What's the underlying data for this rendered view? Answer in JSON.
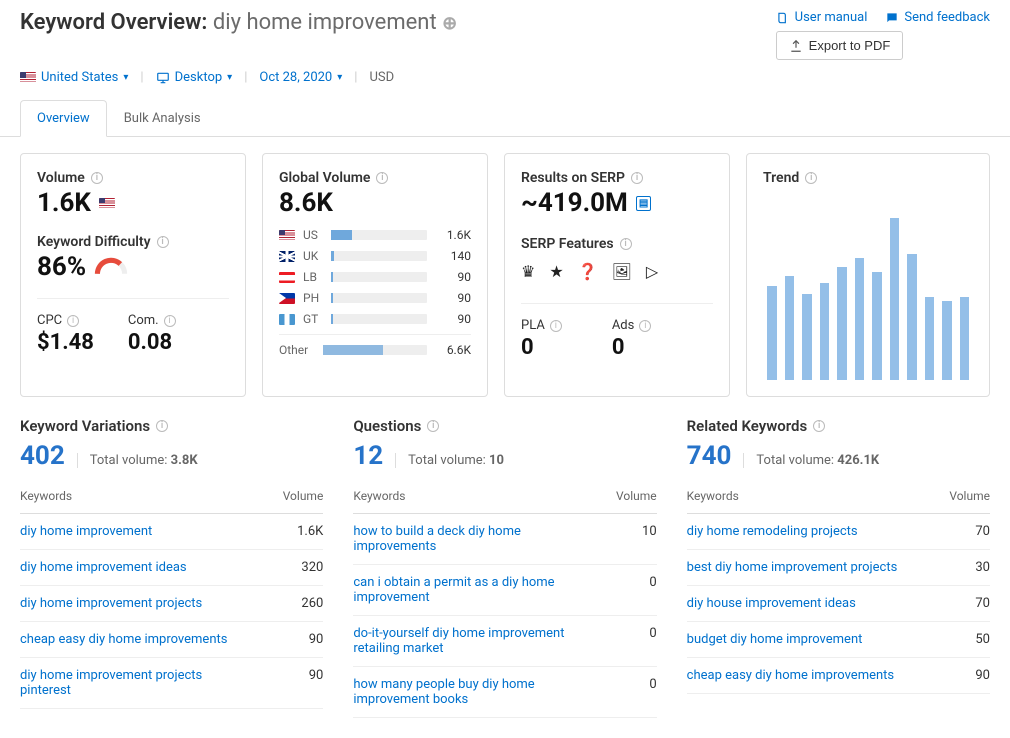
{
  "header": {
    "title_prefix": "Keyword Overview:",
    "keyword": "diy home improvement",
    "user_manual": "User manual",
    "send_feedback": "Send feedback",
    "export": "Export to PDF"
  },
  "filters": {
    "country": "United States",
    "device": "Desktop",
    "date": "Oct 28, 2020",
    "currency": "USD"
  },
  "tabs": {
    "overview": "Overview",
    "bulk": "Bulk Analysis"
  },
  "volume": {
    "label": "Volume",
    "value": "1.6K",
    "kd_label": "Keyword Difficulty",
    "kd_value": "86%",
    "cpc_label": "CPC",
    "cpc_value": "$1.48",
    "com_label": "Com.",
    "com_value": "0.08"
  },
  "global_volume": {
    "label": "Global Volume",
    "value": "8.6K",
    "rows": [
      {
        "cc": "US",
        "flag": "us",
        "pct": 22,
        "num": "1.6K"
      },
      {
        "cc": "UK",
        "flag": "uk",
        "pct": 3,
        "num": "140"
      },
      {
        "cc": "LB",
        "flag": "lb",
        "pct": 2,
        "num": "90"
      },
      {
        "cc": "PH",
        "flag": "ph",
        "pct": 2,
        "num": "90"
      },
      {
        "cc": "GT",
        "flag": "gt",
        "pct": 2,
        "num": "90"
      }
    ],
    "other_label": "Other",
    "other_pct": 58,
    "other_num": "6.6K"
  },
  "serp": {
    "results_label": "Results on SERP",
    "results_value": "~419.0M",
    "features_label": "SERP Features",
    "pla_label": "PLA",
    "pla_value": "0",
    "ads_label": "Ads",
    "ads_value": "0"
  },
  "trend": {
    "label": "Trend"
  },
  "chart_data": {
    "type": "bar",
    "title": "Trend",
    "categories": [
      "1",
      "2",
      "3",
      "4",
      "5",
      "6",
      "7",
      "8",
      "9",
      "10",
      "11",
      "12"
    ],
    "values": [
      52,
      58,
      48,
      54,
      63,
      68,
      60,
      90,
      70,
      46,
      44,
      46
    ],
    "ylim": [
      0,
      100
    ],
    "xlabel": "",
    "ylabel": ""
  },
  "variations": {
    "label": "Keyword Variations",
    "count": "402",
    "total_vol_label": "Total volume:",
    "total_vol": "3.8K",
    "th_kw": "Keywords",
    "th_vol": "Volume",
    "rows": [
      {
        "kw": "diy home improvement",
        "vol": "1.6K"
      },
      {
        "kw": "diy home improvement ideas",
        "vol": "320"
      },
      {
        "kw": "diy home improvement projects",
        "vol": "260"
      },
      {
        "kw": "cheap easy diy home improvements",
        "vol": "90"
      },
      {
        "kw": "diy home improvement projects pinterest",
        "vol": "90"
      }
    ]
  },
  "questions": {
    "label": "Questions",
    "count": "12",
    "total_vol_label": "Total volume:",
    "total_vol": "10",
    "th_kw": "Keywords",
    "th_vol": "Volume",
    "rows": [
      {
        "kw": "how to build a deck diy home improvements",
        "vol": "10"
      },
      {
        "kw": "can i obtain a permit as a diy home improvement",
        "vol": "0"
      },
      {
        "kw": "do-it-yourself diy home improvement retailing market",
        "vol": "0"
      },
      {
        "kw": "how many people buy diy home improvement books",
        "vol": "0"
      }
    ]
  },
  "related": {
    "label": "Related Keywords",
    "count": "740",
    "total_vol_label": "Total volume:",
    "total_vol": "426.1K",
    "th_kw": "Keywords",
    "th_vol": "Volume",
    "rows": [
      {
        "kw": "diy home remodeling projects",
        "vol": "70"
      },
      {
        "kw": "best diy home improvement projects",
        "vol": "30"
      },
      {
        "kw": "diy house improvement ideas",
        "vol": "70"
      },
      {
        "kw": "budget diy home improvement",
        "vol": "50"
      },
      {
        "kw": "cheap easy diy home improvements",
        "vol": "90"
      }
    ]
  }
}
